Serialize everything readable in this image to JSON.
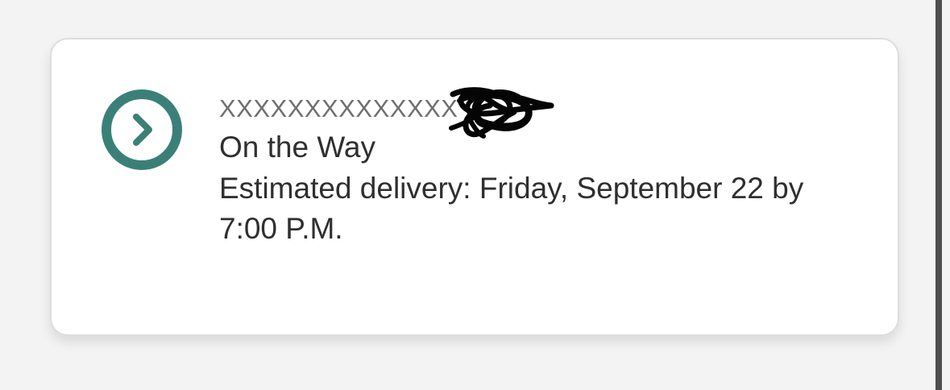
{
  "card": {
    "tracking_number": "XXXXXXXXXXXXXX",
    "status": "On the Way",
    "estimated_delivery": "Estimated delivery: Friday, September 22 by 7:00 P.M."
  },
  "icons": {
    "status": "chevron-right-circle-icon"
  },
  "colors": {
    "accent": "#3b8078",
    "text": "#2f2f2f",
    "muted": "#6f6f6f",
    "background": "#f3f3f3",
    "card": "#ffffff"
  }
}
